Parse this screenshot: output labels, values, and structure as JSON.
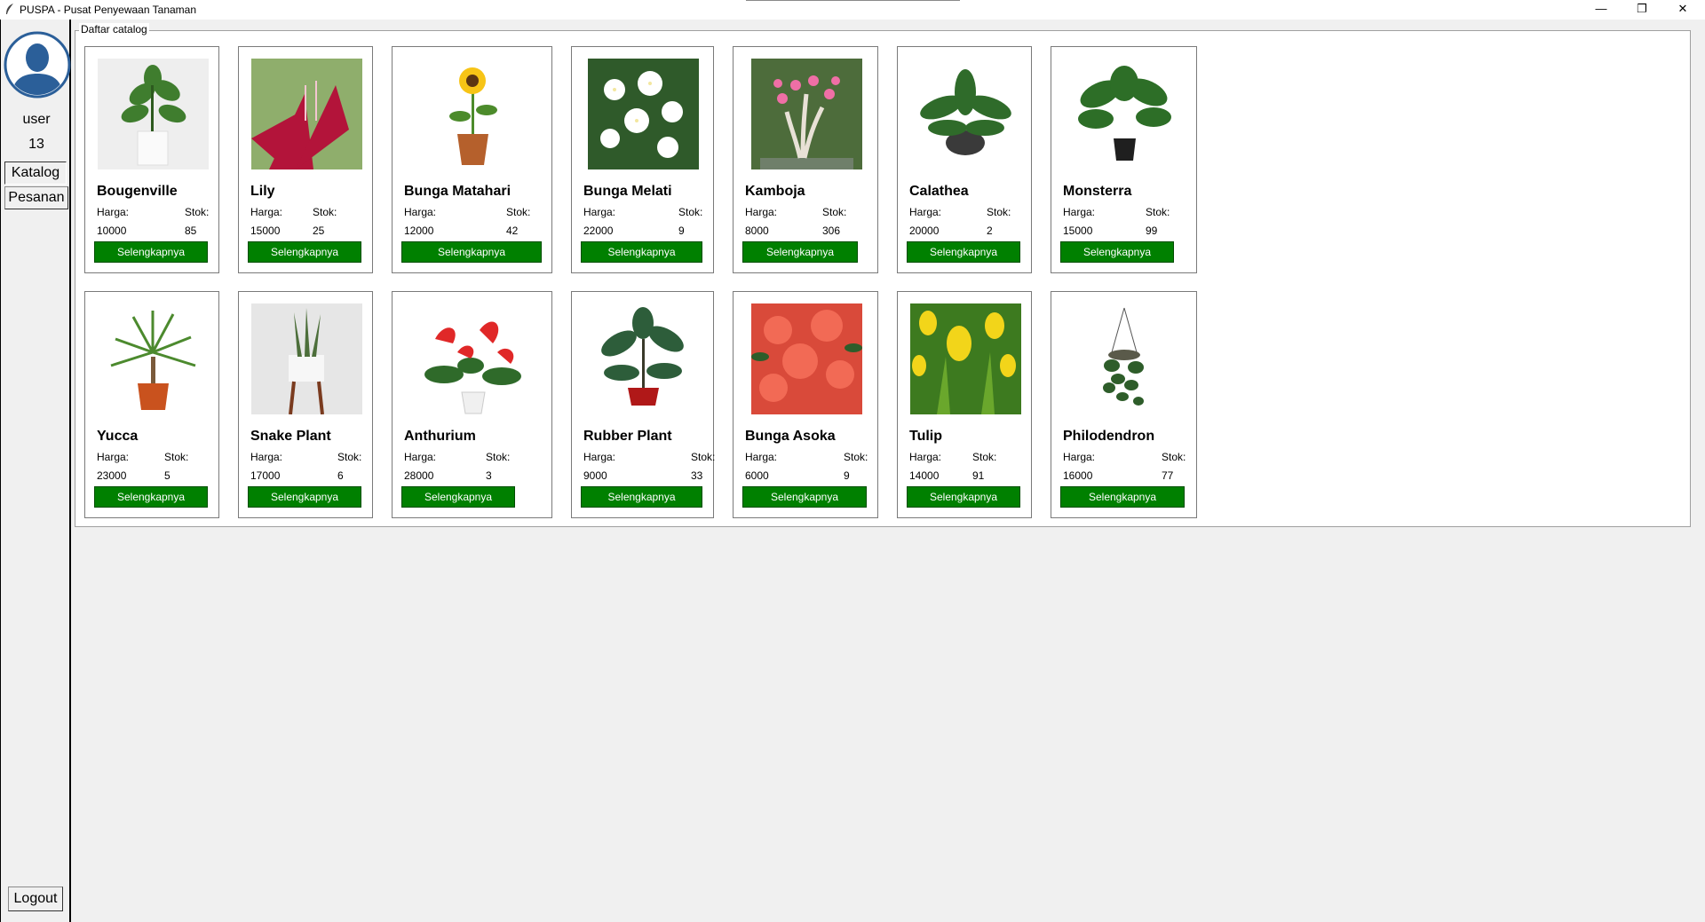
{
  "window": {
    "title": "PUSPA - Pusat Penyewaan Tanaman",
    "minimize_glyph": "—",
    "restore_glyph": "❐",
    "close_glyph": "✕"
  },
  "sidebar": {
    "username": "user",
    "user_number": "13",
    "catalog_button": "Katalog",
    "orders_button": "Pesanan",
    "logout_button": "Logout"
  },
  "catalog": {
    "legend": "Daftar catalog",
    "price_label": "Harga:",
    "stock_label": "Stok:",
    "detail_button": "Selengkapnya",
    "items": [
      {
        "name": "Bougenville",
        "price": "10000",
        "stock": "85",
        "icon": "plant-image"
      },
      {
        "name": "Lily",
        "price": "15000",
        "stock": "25",
        "icon": "flower-image"
      },
      {
        "name": "Bunga Matahari",
        "price": "12000",
        "stock": "42",
        "icon": "sunflower-image"
      },
      {
        "name": "Bunga Melati",
        "price": "22000",
        "stock": "9",
        "icon": "flower-image"
      },
      {
        "name": "Kamboja",
        "price": "8000",
        "stock": "306",
        "icon": "flower-image"
      },
      {
        "name": "Calathea",
        "price": "20000",
        "stock": "2",
        "icon": "plant-image"
      },
      {
        "name": "Monsterra",
        "price": "15000",
        "stock": "99",
        "icon": "plant-image"
      },
      {
        "name": "Yucca",
        "price": "23000",
        "stock": "5",
        "icon": "plant-image"
      },
      {
        "name": "Snake Plant",
        "price": "17000",
        "stock": "6",
        "icon": "plant-image"
      },
      {
        "name": "Anthurium",
        "price": "28000",
        "stock": "3",
        "icon": "flower-image"
      },
      {
        "name": "Rubber Plant",
        "price": "9000",
        "stock": "33",
        "icon": "plant-image"
      },
      {
        "name": "Bunga Asoka",
        "price": "6000",
        "stock": "9",
        "icon": "flower-image"
      },
      {
        "name": "Tulip",
        "price": "14000",
        "stock": "91",
        "icon": "flower-image"
      },
      {
        "name": "Philodendron",
        "price": "16000",
        "stock": "77",
        "icon": "plant-image"
      }
    ]
  },
  "colors": {
    "button_green": "#008000",
    "avatar_blue": "#2b5f99"
  }
}
